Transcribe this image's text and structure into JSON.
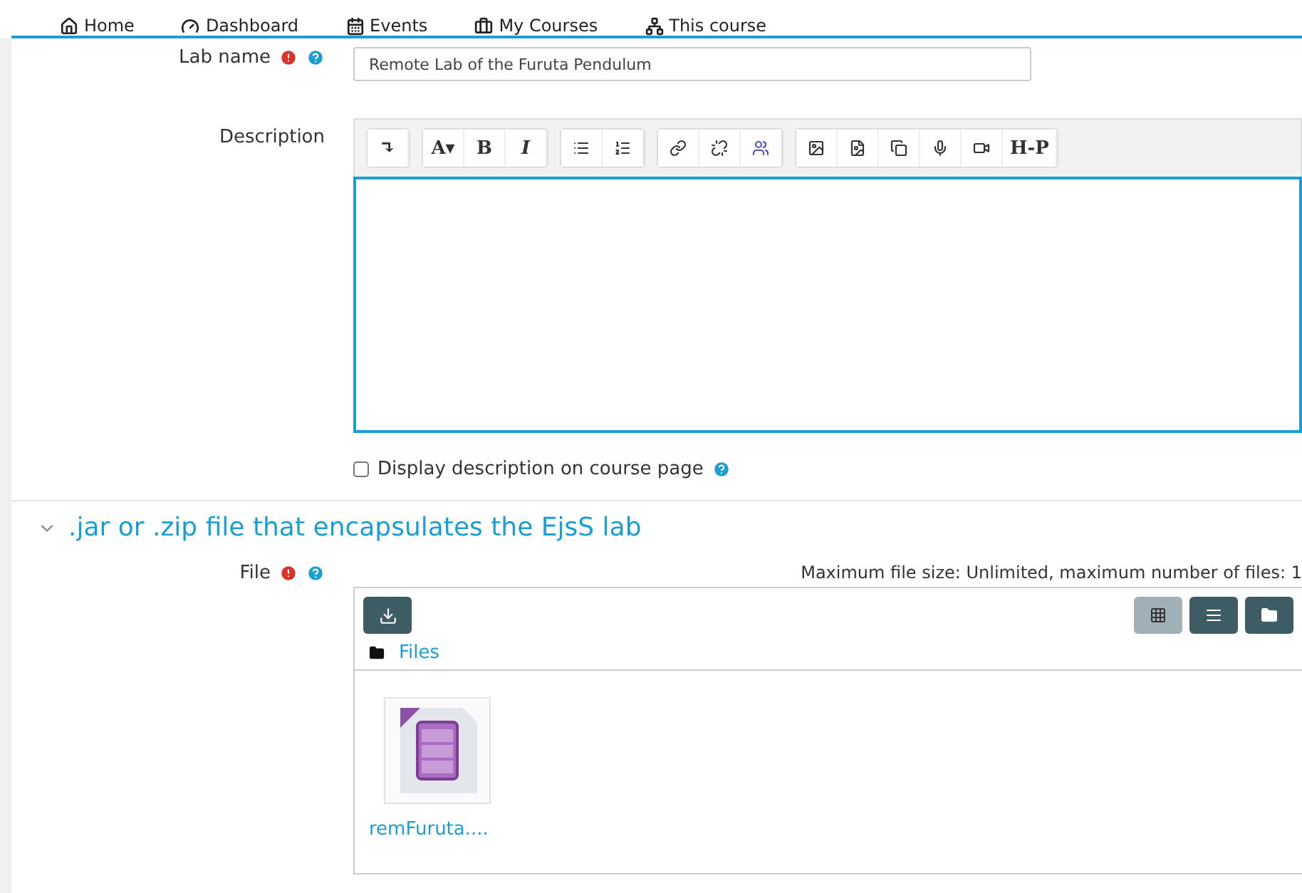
{
  "nav": [
    {
      "label": "Home",
      "kind": "home"
    },
    {
      "label": "Dashboard",
      "kind": "dashboard"
    },
    {
      "label": "Events",
      "kind": "calendar"
    },
    {
      "label": "My Courses",
      "kind": "briefcase"
    },
    {
      "label": "This course",
      "kind": "sitemap"
    }
  ],
  "lab_name": {
    "label": "Lab name",
    "required": true,
    "value": "Remote Lab of the Furuta Pendulum"
  },
  "description": {
    "label": "Description",
    "toolbar": [
      [
        {
          "kind": "text",
          "label": "↴"
        }
      ],
      [
        {
          "kind": "text",
          "label": "A▾"
        },
        {
          "kind": "text",
          "label": "B"
        },
        {
          "kind": "text",
          "label": "I"
        }
      ],
      [
        {
          "kind": "bullets"
        },
        {
          "kind": "numbers"
        }
      ],
      [
        {
          "kind": "link"
        },
        {
          "kind": "unlink"
        },
        {
          "kind": "teams"
        }
      ],
      [
        {
          "kind": "image"
        },
        {
          "kind": "media"
        },
        {
          "kind": "copy"
        },
        {
          "kind": "mic"
        },
        {
          "kind": "video"
        },
        {
          "kind": "text",
          "label": "H-P"
        }
      ]
    ]
  },
  "display_description": {
    "label": "Display description on course page",
    "checked": false
  },
  "section": {
    "title": ".jar or .zip file that encapsulates the EjsS lab",
    "expanded": true
  },
  "file": {
    "label": "File",
    "required": true,
    "limits": "Maximum file size: Unlimited, maximum number of files: 1",
    "views": [
      {
        "kind": "grid",
        "selected": true
      },
      {
        "kind": "list",
        "selected": false
      },
      {
        "kind": "tree",
        "selected": false
      }
    ],
    "folder": "Files",
    "files": [
      {
        "name": "remFuruta...."
      }
    ]
  }
}
